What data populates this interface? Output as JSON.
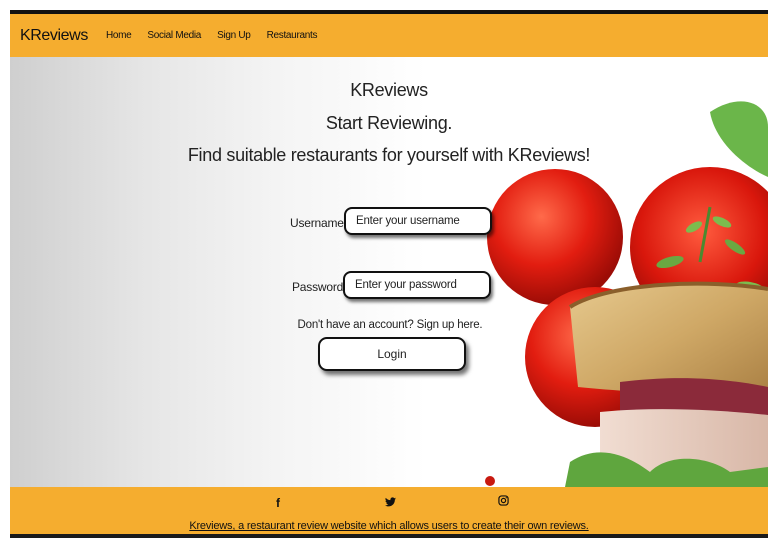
{
  "nav": {
    "brand": "KReviews",
    "links": [
      "Home",
      "Social Media",
      "Sign Up",
      "Restaurants"
    ]
  },
  "hero": {
    "title": "KReviews",
    "subtitle": "Start Reviewing.",
    "tagline": "Find suitable restaurants for yourself with KReviews!"
  },
  "form": {
    "username_label": "Username:",
    "username_placeholder": "Enter your username",
    "password_label": "Password:",
    "password_placeholder": "Enter your password",
    "signup_text": "Don't have an account? Sign up here.",
    "login_label": "Login"
  },
  "footer": {
    "icons": [
      "facebook-icon",
      "twitter-icon",
      "instagram-icon"
    ],
    "description": "Kreviews, a restaurant review website which allows users to create their own reviews."
  },
  "colors": {
    "accent": "#f5ad2f"
  }
}
